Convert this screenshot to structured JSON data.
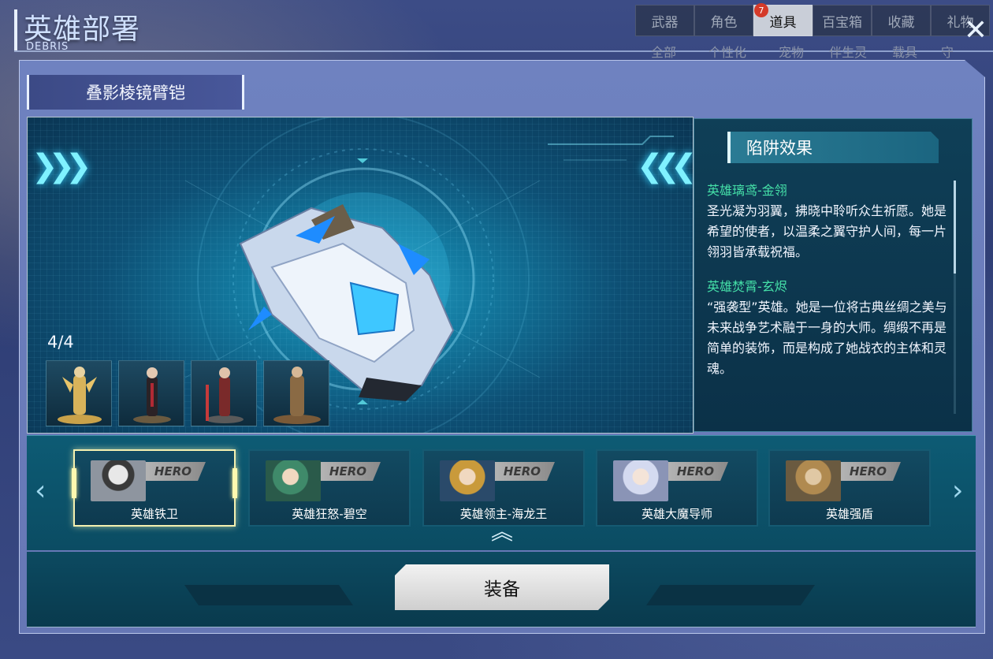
{
  "header": {
    "title": "英雄部署",
    "subtitle": "DEBRIS"
  },
  "top_tabs": [
    {
      "label": "武器",
      "active": false
    },
    {
      "label": "角色",
      "active": false
    },
    {
      "label": "道具",
      "active": true,
      "badge": "7"
    },
    {
      "label": "百宝箱",
      "active": false
    },
    {
      "label": "收藏",
      "active": false
    },
    {
      "label": "礼物",
      "active": false
    }
  ],
  "sub_tabs": [
    "全部",
    "个性化",
    "宠物",
    "伴生灵",
    "载具",
    "守"
  ],
  "item": {
    "name": "叠影棱镜臂铠",
    "count": "4/4",
    "thumbnail_icons": [
      "hero-figure-gold-icon",
      "hero-figure-dark-icon",
      "hero-figure-red-icon",
      "hero-figure-bronze-icon"
    ]
  },
  "info": {
    "header": "陷阱效果",
    "entries": [
      {
        "title": "英雄璃鸢-金翎",
        "text": "圣光凝为羽翼，拂晓中聆听众生祈愿。她是希望的使者，以温柔之翼守护人间，每一片翎羽皆承载祝福。"
      },
      {
        "title": "英雄焚霄-玄烬",
        "text": "“强袭型”英雄。她是一位将古典丝绸之美与未来战争艺术融于一身的大师。绸缎不再是简单的装饰，而是构成了她战衣的主体和灵魂。"
      }
    ]
  },
  "heroes": [
    {
      "name": "英雄铁卫",
      "tag": "HERO",
      "selected": true,
      "color": "#8e959f"
    },
    {
      "name": "英雄狂怒-碧空",
      "tag": "HERO",
      "selected": false,
      "color": "#3f8a6a"
    },
    {
      "name": "英雄领主-海龙王",
      "tag": "HERO",
      "selected": false,
      "color": "#c99a3b"
    },
    {
      "name": "英雄大魔导师",
      "tag": "HERO",
      "selected": false,
      "color": "#c6cde6"
    },
    {
      "name": "英雄强盾",
      "tag": "HERO",
      "selected": false,
      "color": "#b08a50"
    }
  ],
  "actions": {
    "equip_label": "装备",
    "close_label": "✕",
    "prev_hero_label": "‹",
    "next_hero_label": "›",
    "prev_item_label": "❯❯❯",
    "next_item_label": "❮❮❮",
    "expand_label": "︽"
  },
  "colors": {
    "accent_cyan": "#7ff1ff",
    "hero_name_green": "#45e0a8",
    "tab_active": "#c9ced8",
    "badge_red": "#d43a2a"
  }
}
